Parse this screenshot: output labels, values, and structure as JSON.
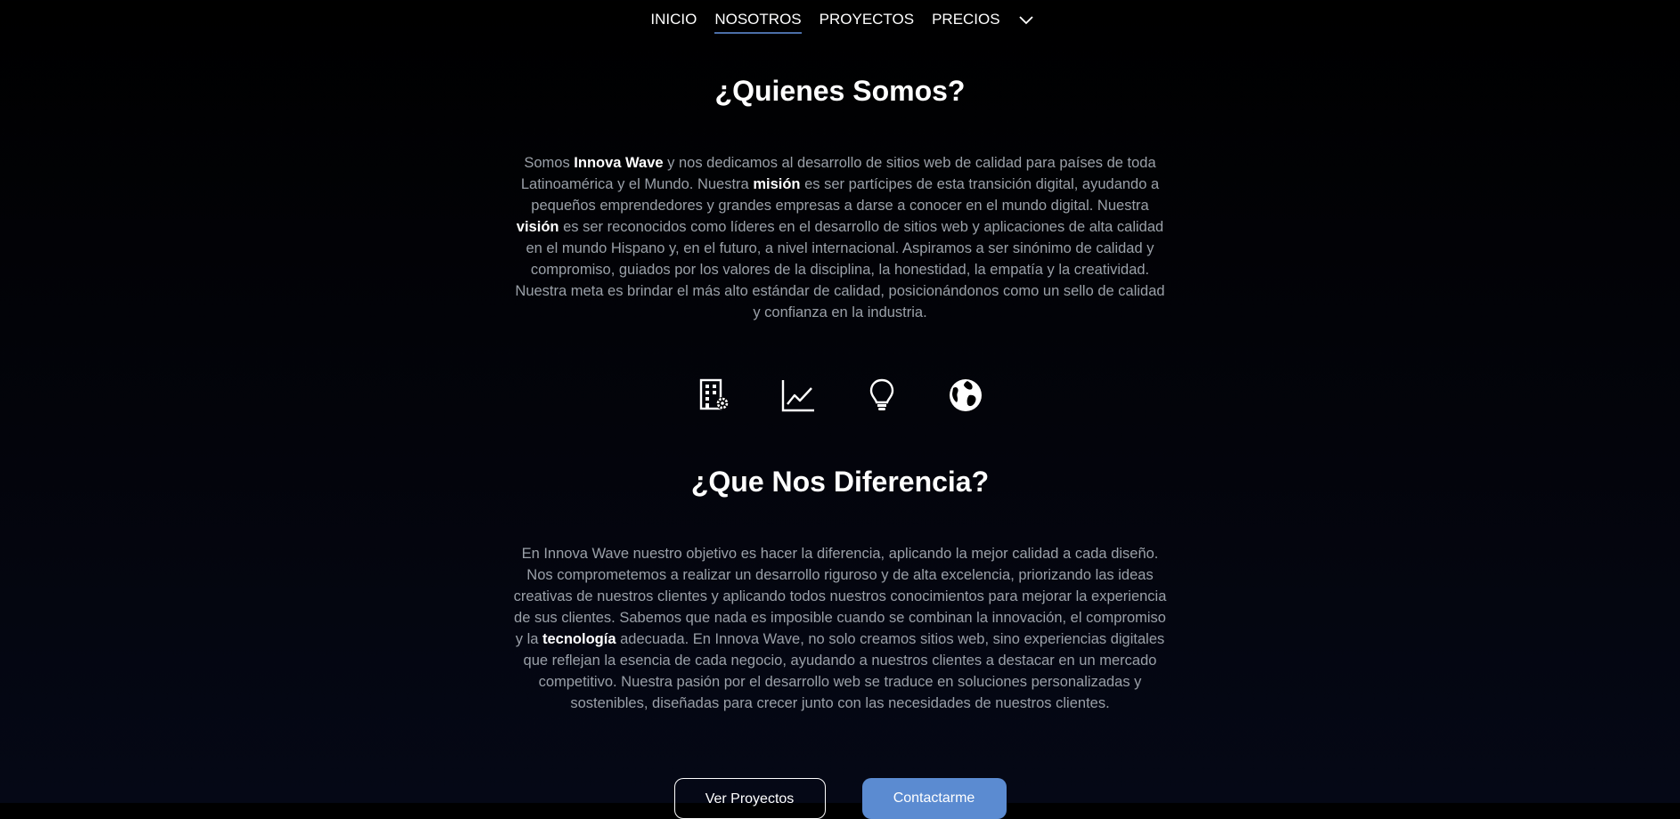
{
  "nav": {
    "items": [
      {
        "label": "INICIO",
        "active": false
      },
      {
        "label": "NOSOTROS",
        "active": true
      },
      {
        "label": "PROYECTOS",
        "active": false
      },
      {
        "label": "PRECIOS",
        "active": false
      }
    ],
    "more_icon": "chevron-down-icon",
    "active_underline_color": "#4b6ea8"
  },
  "about": {
    "title": "¿Quienes Somos?",
    "p_segments": [
      "Somos ",
      "Innova Wave",
      " y nos dedicamos al desarrollo de sitios web de calidad para países de toda Latinoamérica y el Mundo. Nuestra ",
      "misión",
      " es ser partícipes de esta transición digital, ayudando a pequeños emprendedores y grandes empresas a darse a conocer en el mundo digital. Nuestra ",
      "visión",
      " es ser reconocidos como líderes en el desarrollo de sitios web y aplicaciones de alta calidad en el mundo Hispano y, en el futuro, a nivel internacional. Aspiramos a ser sinónimo de calidad y compromiso, guiados por los valores de la disciplina, la honestidad, la empatía y la creatividad. Nuestra meta es brindar el más alto estándar de calidad, posicionándonos como un sello de calidad y confianza en la industria."
    ]
  },
  "icons": [
    "building-gear-icon",
    "line-chart-icon",
    "lightbulb-icon",
    "globe-icon"
  ],
  "difference": {
    "title": "¿Que Nos Diferencia?",
    "p_segments": [
      "En Innova Wave nuestro objetivo es hacer la diferencia, aplicando la mejor calidad a cada diseño. Nos comprometemos a realizar un desarrollo riguroso y de alta excelencia, priorizando las ideas creativas de nuestros clientes y aplicando todos nuestros conocimientos para mejorar la experiencia de sus clientes. Sabemos que nada es imposible cuando se combinan la innovación, el compromiso y la ",
      "tecnología",
      " adecuada. En Innova Wave, no solo creamos sitios web, sino experiencias digitales que reflejan la esencia de cada negocio, ayudando a nuestros clientes a destacar en un mercado competitivo. Nuestra pasión por el desarrollo web se traduce en soluciones personalizadas y sostenibles, diseñadas para crecer junto con las necesidades de nuestros clientes."
    ]
  },
  "buttons": {
    "projects_label": "Ver Proyectos",
    "contact_label": "Contactarme",
    "contact_color": "#5b8bd1"
  }
}
